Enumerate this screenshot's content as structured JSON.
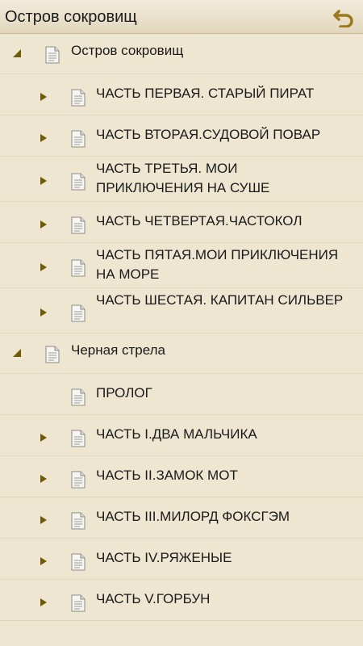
{
  "header": {
    "title": "Остров сокровищ",
    "back_icon": "undo-arrow-icon",
    "back_color": "#9a7a1a"
  },
  "colors": {
    "background": "#efe6d2",
    "arrow": "#6e5a07",
    "divider": "#e3d7bd"
  },
  "tree": {
    "books": [
      {
        "title": "Остров сокровищ",
        "expanded": true,
        "chapters": [
          {
            "label": "ЧАСТЬ ПЕРВАЯ. СТАРЫЙ ПИРАТ",
            "has_children": true
          },
          {
            "label": "ЧАСТЬ ВТОРАЯ.СУДОВОЙ ПОВАР",
            "has_children": true
          },
          {
            "label": "ЧАСТЬ ТРЕТЬЯ. МОИ ПРИКЛЮЧЕНИЯ НА СУШЕ",
            "has_children": true
          },
          {
            "label": "ЧАСТЬ ЧЕТВЕРТАЯ.ЧАСТОКОЛ",
            "has_children": true
          },
          {
            "label": "ЧАСТЬ ПЯТАЯ.МОИ ПРИКЛЮЧЕНИЯ НА МОРЕ",
            "has_children": true
          },
          {
            "label": "ЧАСТЬ ШЕСТАЯ. КАПИТАН СИЛЬВЕР",
            "has_children": true
          }
        ]
      },
      {
        "title": "Черная стрела",
        "expanded": true,
        "chapters": [
          {
            "label": "ПРОЛОГ",
            "has_children": false
          },
          {
            "label": "ЧАСТЬ I.ДВА МАЛЬЧИКА",
            "has_children": true
          },
          {
            "label": "ЧАСТЬ II.ЗАМОК МОТ",
            "has_children": true
          },
          {
            "label": "ЧАСТЬ III.МИЛОРД ФОКСГЭМ",
            "has_children": true
          },
          {
            "label": "ЧАСТЬ IV.РЯЖЕНЫЕ",
            "has_children": true
          },
          {
            "label": "ЧАСТЬ V.ГОРБУН",
            "has_children": true
          }
        ]
      }
    ]
  }
}
